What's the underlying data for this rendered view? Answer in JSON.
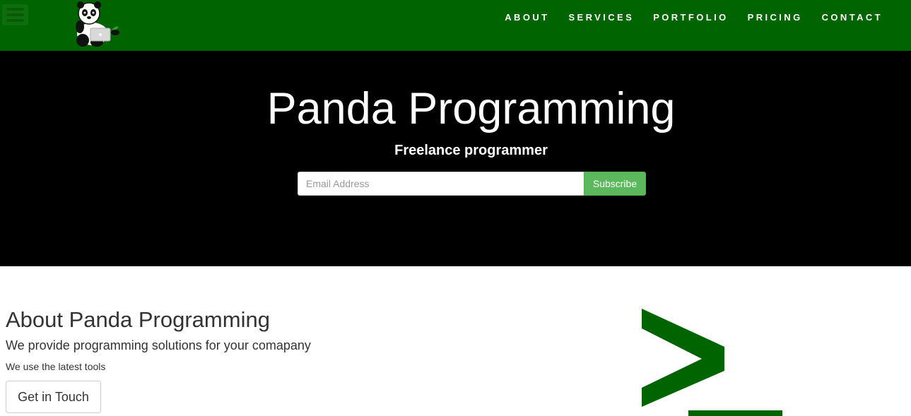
{
  "navbar": {
    "bg_color": "#006400",
    "menu_icon": "hamburger-icon",
    "logo": "panda-with-laptop-logo",
    "links": [
      "ABOUT",
      "SERVICES",
      "PORTFOLIO",
      "PRICING",
      "CONTACT"
    ]
  },
  "hero": {
    "title": "Panda Programming",
    "subtitle": "Freelance programmer",
    "email_placeholder": "Email Address",
    "subscribe_label": "Subscribe",
    "button_color": "#5cb85c"
  },
  "about": {
    "title": "About Panda Programming",
    "subtitle": "We provide programming solutions for your comapany",
    "small_text": "We use the latest tools",
    "cta_label": "Get in Touch",
    "icon": "terminal-prompt-icon",
    "icon_color": "#006400"
  }
}
